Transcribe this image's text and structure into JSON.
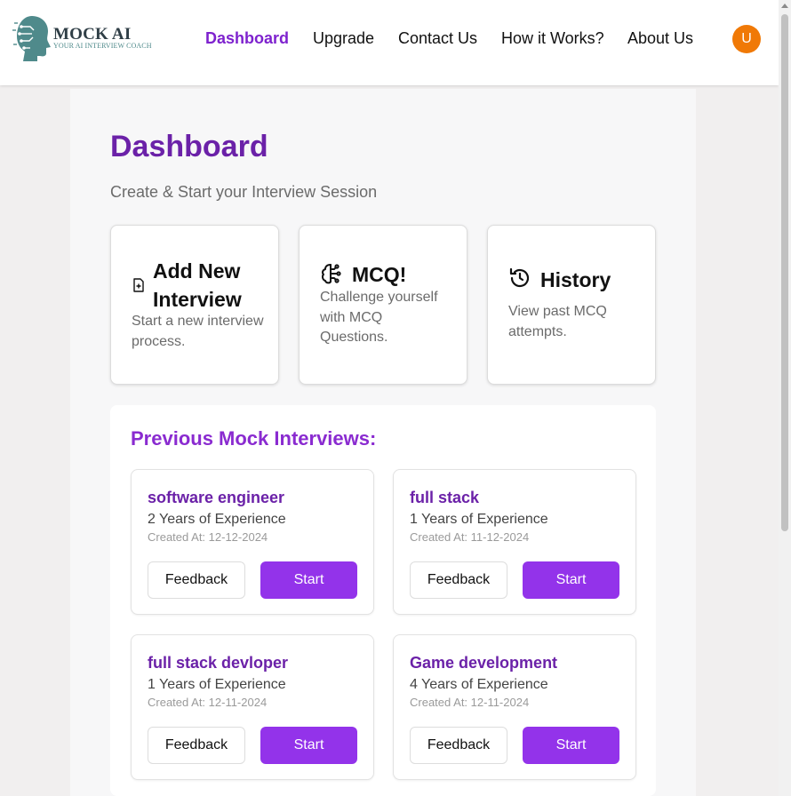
{
  "header": {
    "logo": {
      "name": "MOCK AI",
      "tagline": "YOUR AI INTERVIEW COACH"
    },
    "nav": [
      {
        "label": "Dashboard",
        "active": true
      },
      {
        "label": "Upgrade",
        "active": false
      },
      {
        "label": "Contact Us",
        "active": false
      },
      {
        "label": "How it Works?",
        "active": false
      },
      {
        "label": "About Us",
        "active": false
      }
    ],
    "avatar_initial": "U"
  },
  "dashboard": {
    "title": "Dashboard",
    "subtitle": "Create & Start your Interview Session",
    "cards": [
      {
        "title": "Add New Interview",
        "description": "Start a new interview process.",
        "icon": "file-plus-icon"
      },
      {
        "title": "MCQ!",
        "description": "Challenge yourself with MCQ Questions.",
        "icon": "brain-icon"
      },
      {
        "title": "History",
        "description": "View past MCQ attempts.",
        "icon": "history-icon"
      }
    ]
  },
  "previous": {
    "title": "Previous Mock Interviews:",
    "interviews": [
      {
        "role": "software engineer",
        "experience": "2 Years of Experience",
        "created": "Created At: 12-12-2024",
        "feedback_label": "Feedback",
        "start_label": "Start"
      },
      {
        "role": "full stack",
        "experience": "1 Years of Experience",
        "created": "Created At: 11-12-2024",
        "feedback_label": "Feedback",
        "start_label": "Start"
      },
      {
        "role": "full stack devloper",
        "experience": "1 Years of Experience",
        "created": "Created At: 12-11-2024",
        "feedback_label": "Feedback",
        "start_label": "Start"
      },
      {
        "role": "Game development",
        "experience": "4 Years of Experience",
        "created": "Created At: 12-11-2024",
        "feedback_label": "Feedback",
        "start_label": "Start"
      }
    ]
  },
  "colors": {
    "primary": "#7e22ce",
    "button": "#9333ea",
    "avatar": "#f07906"
  }
}
